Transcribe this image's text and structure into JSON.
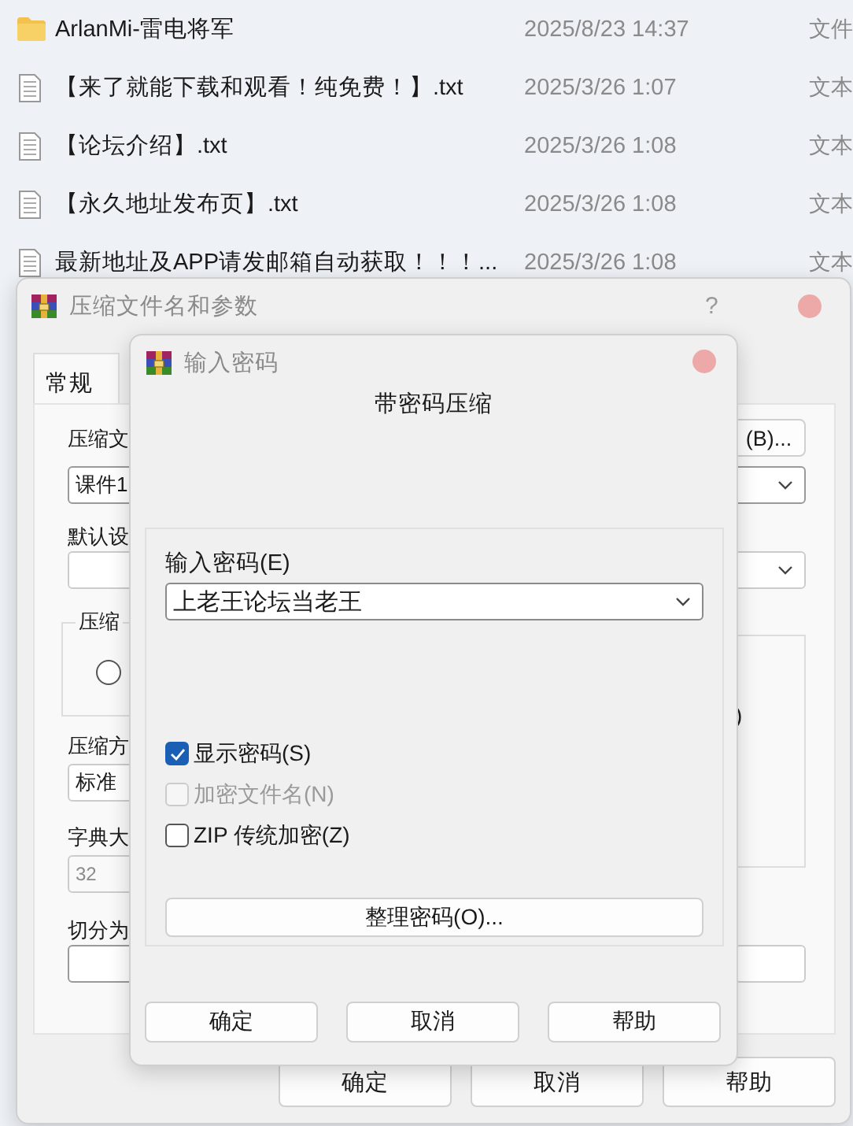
{
  "file_list": {
    "rows": [
      {
        "kind": "folder",
        "name": "ArlanMi-雷电将军",
        "modified": "2025/8/23 14:37",
        "type": "文件"
      },
      {
        "kind": "text",
        "name": "【来了就能下载和观看！纯免费！】.txt",
        "modified": "2025/3/26 1:07",
        "type": "文本"
      },
      {
        "kind": "text",
        "name": "【论坛介绍】.txt",
        "modified": "2025/3/26 1:08",
        "type": "文本"
      },
      {
        "kind": "text",
        "name": "【永久地址发布页】.txt",
        "modified": "2025/3/26 1:08",
        "type": "文本"
      },
      {
        "kind": "text",
        "name": "最新地址及APP请发邮箱自动获取！！！...",
        "modified": "2025/3/26 1:08",
        "type": "文本"
      }
    ]
  },
  "archive_dialog": {
    "title": "压缩文件名和参数",
    "help": "?",
    "tabs": [
      {
        "label": "常规",
        "selected": true
      }
    ],
    "filename_label": "压缩文",
    "browse_button": "(B)...",
    "filename_value": "课件1",
    "profile_label": "默认设",
    "format_group_label": "压缩",
    "format_radio": {
      "selected": false
    },
    "options_fragment": ")",
    "method_label": "压缩方",
    "method_value": "标准",
    "dictionary_label": "字典大",
    "dictionary_value": "32",
    "split_label": "切分为",
    "buttons": [
      "确定",
      "取消",
      "帮助"
    ]
  },
  "password_dialog": {
    "title": "输入密码",
    "heading": "带密码压缩",
    "password_label": "输入密码(E)",
    "password_value": "上老王论坛当老王",
    "checkboxes": [
      {
        "label": "显示密码(S)",
        "checked": true,
        "disabled": false
      },
      {
        "label": "加密文件名(N)",
        "checked": false,
        "disabled": true
      },
      {
        "label": "ZIP 传统加密(Z)",
        "checked": false,
        "disabled": false
      }
    ],
    "organize_button": "整理密码(O)...",
    "buttons": [
      "确定",
      "取消",
      "帮助"
    ]
  }
}
